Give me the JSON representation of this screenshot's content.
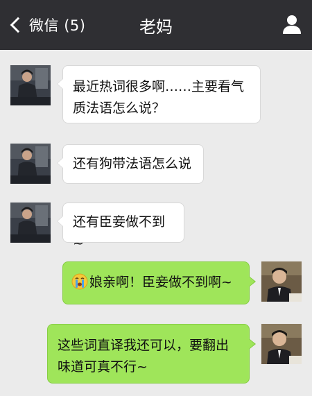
{
  "header": {
    "back_label": "微信",
    "unread": "(5)",
    "title": "老妈"
  },
  "messages": [
    {
      "side": "left",
      "text": "最近热词很多啊……主要看气质法语怎么说？"
    },
    {
      "side": "left",
      "text": "还有狗带法语怎么说"
    },
    {
      "side": "left",
      "text": "还有臣妾做不到~"
    },
    {
      "side": "right",
      "emoji": "crying-face",
      "text": "娘亲啊！臣妾做不到啊~"
    },
    {
      "side": "right",
      "text": "这些词直译我还可以，要翻出味道可真不行~"
    }
  ],
  "colors": {
    "topbar": "#2f2f33",
    "background": "#ebebeb",
    "bubble_left": "#ffffff",
    "bubble_right": "#9fe55a"
  }
}
